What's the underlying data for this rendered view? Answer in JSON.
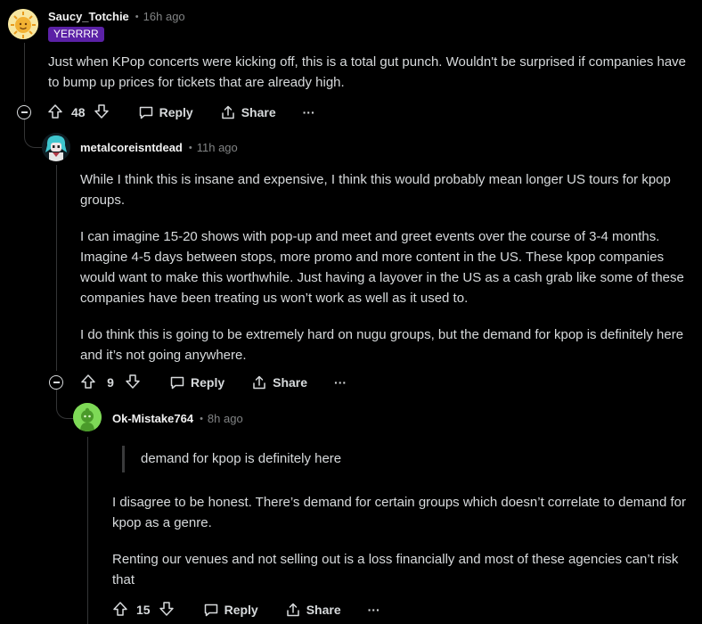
{
  "comments": [
    {
      "author": "Saucy_Totchie",
      "time": "16h ago",
      "flair": "YERRRR",
      "body": [
        "Just when KPop concerts were kicking off, this is a total gut punch. Wouldn't be surprised if companies have to bump up prices for tickets that are already high."
      ],
      "score": "48",
      "reply_label": "Reply",
      "share_label": "Share",
      "more_label": "···"
    },
    {
      "author": "metalcoreisntdead",
      "time": "11h ago",
      "body": [
        "While I think this is insane and expensive, I think this would probably mean longer US tours for kpop groups.",
        "I can imagine 15-20 shows with pop-up and meet and greet events over the course of 3-4 months. Imagine 4-5 days between stops, more promo and more content in the US. These kpop companies would want to make this worthwhile. Just having a layover in the US as a cash grab like some of these companies have been treating us won’t work as well as it used to.",
        "I do think this is going to be extremely hard on nugu groups, but the demand for kpop is definitely here and it’s not going anywhere."
      ],
      "score": "9",
      "reply_label": "Reply",
      "share_label": "Share",
      "more_label": "···"
    },
    {
      "author": "Ok-Mistake764",
      "time": "8h ago",
      "quote": "demand for kpop is definitely here",
      "body": [
        "I disagree to be honest. There’s demand for certain groups which doesn’t correlate to demand for kpop as a genre.",
        "Renting our venues and not selling out is a loss financially and most of these agencies can’t risk that"
      ],
      "score": "15",
      "reply_label": "Reply",
      "share_label": "Share",
      "more_label": "···"
    }
  ],
  "separator": "•",
  "colors": {
    "background": "#000000",
    "text": "#d7dadc",
    "muted": "#818384",
    "flair_bg": "#5b21a6",
    "thread_line": "#343536"
  }
}
